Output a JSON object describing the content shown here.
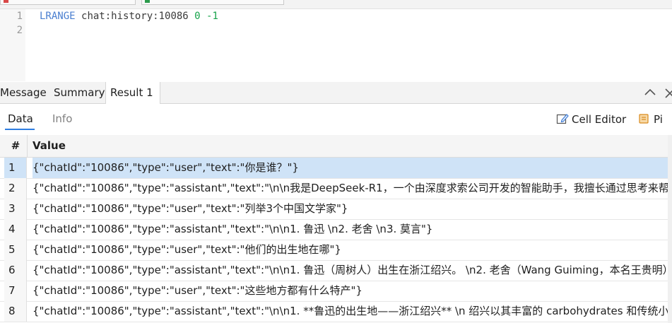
{
  "editor": {
    "lines": [
      {
        "number": "1",
        "command": "LRANGE",
        "key": "chat:history:10086",
        "start": "0",
        "stop": "-1"
      },
      {
        "number": "2"
      }
    ]
  },
  "result_tabs": {
    "message": "Message",
    "summary": "Summary",
    "result": "Result 1"
  },
  "subtabs": {
    "data": "Data",
    "info": "Info"
  },
  "toolbar": {
    "cell_editor": "Cell Editor",
    "pin": "Pi"
  },
  "grid": {
    "columns": [
      "#",
      "Value"
    ],
    "rows": [
      {
        "n": "1",
        "value": "{\"chatId\":\"10086\",\"type\":\"user\",\"text\":\"你是谁？\"}"
      },
      {
        "n": "2",
        "value": "{\"chatId\":\"10086\",\"type\":\"assistant\",\"text\":\"\\n\\n我是DeepSeek-R1，一个由深度求索公司开发的智能助手，我擅长通过思考来帮您解"
      },
      {
        "n": "3",
        "value": "{\"chatId\":\"10086\",\"type\":\"user\",\"text\":\"列举3个中国文学家\"}"
      },
      {
        "n": "4",
        "value": "{\"chatId\":\"10086\",\"type\":\"assistant\",\"text\":\"\\n\\n1. 鲁迅 \\n2. 老舍 \\n3. 莫言\"}"
      },
      {
        "n": "5",
        "value": "{\"chatId\":\"10086\",\"type\":\"user\",\"text\":\"他们的出生地在哪\"}"
      },
      {
        "n": "6",
        "value": "{\"chatId\":\"10086\",\"type\":\"assistant\",\"text\":\"\\n\\n1. 鲁迅（周树人）出生在浙江绍兴。 \\n2. 老舍（Wang Guiming，本名王贵明）出"
      },
      {
        "n": "7",
        "value": "{\"chatId\":\"10086\",\"type\":\"user\",\"text\":\"这些地方都有什么特产\"}"
      },
      {
        "n": "8",
        "value": "{\"chatId\":\"10086\",\"type\":\"assistant\",\"text\":\"\\n\\n1. **鲁迅的出生地——浙江绍兴** \\n   绍兴以其丰富的 carbohydrates 和传统小吃"
      }
    ]
  },
  "colors": {
    "selected_row": "#cfe3f7",
    "tab_underline": "#2f7de1",
    "keyword": "#4a7fd0",
    "number": "#16a34a"
  },
  "icons": [
    "cell-editor-icon",
    "pin-icon",
    "collapse-up-icon",
    "close-icon"
  ]
}
